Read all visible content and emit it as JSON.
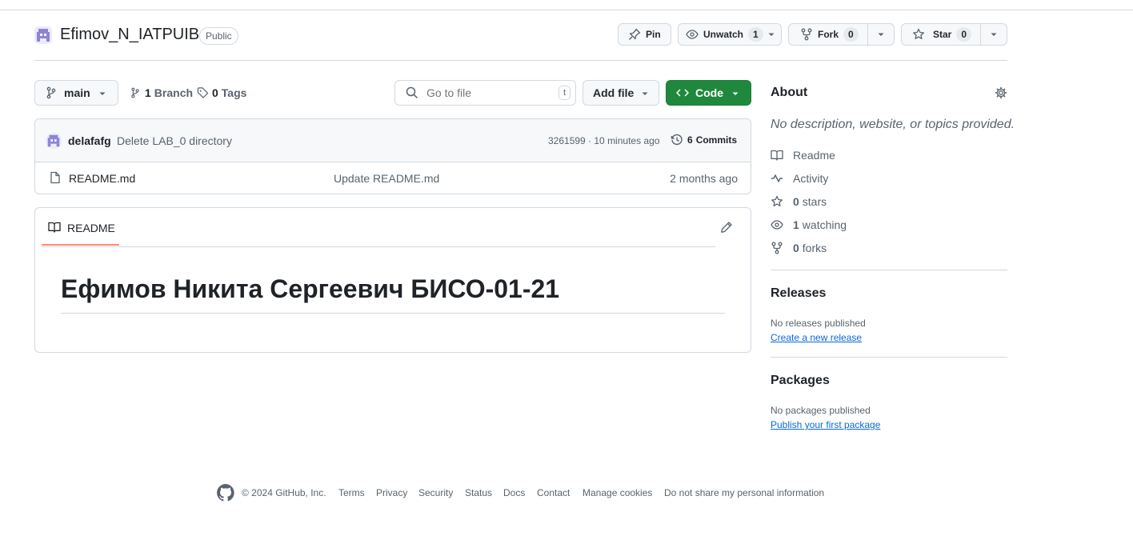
{
  "repo": {
    "name": "Efimov_N_IATPUIB",
    "visibility": "Public",
    "pin_label": "Pin",
    "unwatch_label": "Unwatch",
    "watch_count": "1",
    "fork_label": "Fork",
    "fork_count": "0",
    "star_label": "Star",
    "star_count": "0"
  },
  "toolbar": {
    "branch": "main",
    "branch_count": "1",
    "branch_word": "Branch",
    "tag_count": "0",
    "tag_word": "Tags",
    "search_placeholder": "Go to file",
    "search_shortcut": "t",
    "add_file": "Add file",
    "code": "Code"
  },
  "commit": {
    "author": "delafafg",
    "message": "Delete LAB_0 directory",
    "hash_time": "3261599 · 10 minutes ago",
    "commits_count": "6",
    "commits_word": "Commits"
  },
  "files": [
    {
      "name": "README.md",
      "message": "Update README.md",
      "time": "2 months ago"
    }
  ],
  "readme": {
    "tab": "README",
    "heading": "Ефимов Никита Сергеевич БИСО-01-21"
  },
  "about": {
    "title": "About",
    "description": "No description, website, or topics provided.",
    "readme": "Readme",
    "activity": "Activity",
    "stars_count": "0",
    "stars_word": "stars",
    "watching_count": "1",
    "watching_word": "watching",
    "forks_count": "0",
    "forks_word": "forks"
  },
  "releases": {
    "title": "Releases",
    "empty": "No releases published",
    "link": "Create a new release"
  },
  "packages": {
    "title": "Packages",
    "empty": "No packages published",
    "link": "Publish your first package"
  },
  "footer": {
    "copyright": "© 2024 GitHub, Inc.",
    "links": [
      "Terms",
      "Privacy",
      "Security",
      "Status",
      "Docs",
      "Contact",
      "Manage cookies",
      "Do not share my personal information"
    ]
  },
  "colors": {
    "code_button": "#1f883d",
    "link": "#0969da",
    "tab_underline": "#fd8c73",
    "avatar": "#8b84d7"
  }
}
